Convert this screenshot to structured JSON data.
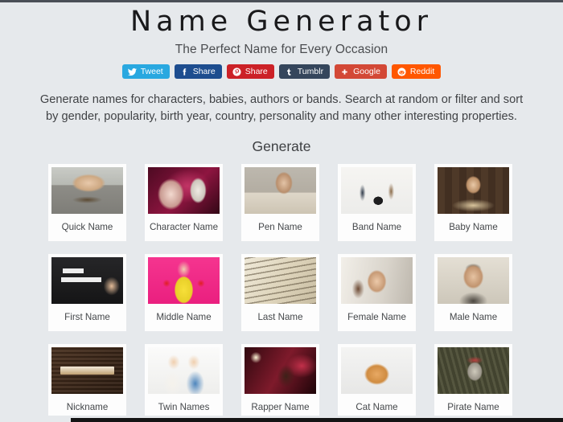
{
  "header": {
    "title": "Name Generator",
    "tagline": "The Perfect Name for Every Occasion"
  },
  "share_buttons": [
    {
      "label": "Tweet",
      "network": "twitter",
      "icon": "twitter-bird-icon",
      "color": "#29a8e0"
    },
    {
      "label": "Share",
      "network": "facebook",
      "icon": "facebook-f-icon",
      "color": "#1d4d8f"
    },
    {
      "label": "Share",
      "network": "pinterest",
      "icon": "pinterest-p-icon",
      "color": "#cc2127"
    },
    {
      "label": "Tumblr",
      "network": "tumblr",
      "icon": "tumblr-t-icon",
      "color": "#35465c"
    },
    {
      "label": "Google",
      "network": "google",
      "icon": "google-plus-icon",
      "color": "#d34836"
    },
    {
      "label": "Reddit",
      "network": "reddit",
      "icon": "reddit-alien-icon",
      "color": "#ff5700"
    }
  ],
  "intro": {
    "description": "Generate names for characters, babies, authors or bands. Search at random or filter and sort by gender, popularity, birth year, country, personality and many other interesting properties.",
    "section_heading": "Generate"
  },
  "generators": [
    {
      "label": "Quick Name",
      "thumb": "skateboarder-photo"
    },
    {
      "label": "Character Name",
      "thumb": "masked-woman-photo"
    },
    {
      "label": "Pen Name",
      "thumb": "writer-at-desk-photo"
    },
    {
      "label": "Band Name",
      "thumb": "rock-band-photo"
    },
    {
      "label": "Baby Name",
      "thumb": "baby-with-books-photo"
    },
    {
      "label": "First Name",
      "thumb": "hello-my-name-is-photo"
    },
    {
      "label": "Middle Name",
      "thumb": "woman-yellow-dress-photo"
    },
    {
      "label": "Last Name",
      "thumb": "dictionary-surname-photo"
    },
    {
      "label": "Female Name",
      "thumb": "smiling-woman-photo"
    },
    {
      "label": "Male Name",
      "thumb": "smiling-man-glasses-photo"
    },
    {
      "label": "Nickname",
      "thumb": "nickname-wood-sign-photo"
    },
    {
      "label": "Twin Names",
      "thumb": "twin-sisters-photo"
    },
    {
      "label": "Rapper Name",
      "thumb": "rapper-on-stage-photo"
    },
    {
      "label": "Cat Name",
      "thumb": "orange-kitten-photo"
    },
    {
      "label": "Pirate Name",
      "thumb": "pirate-skeleton-photo"
    }
  ],
  "theme": {
    "page_background": "#e6e9ec",
    "card_background": "#fdfdfd",
    "text_color": "#44474a"
  }
}
